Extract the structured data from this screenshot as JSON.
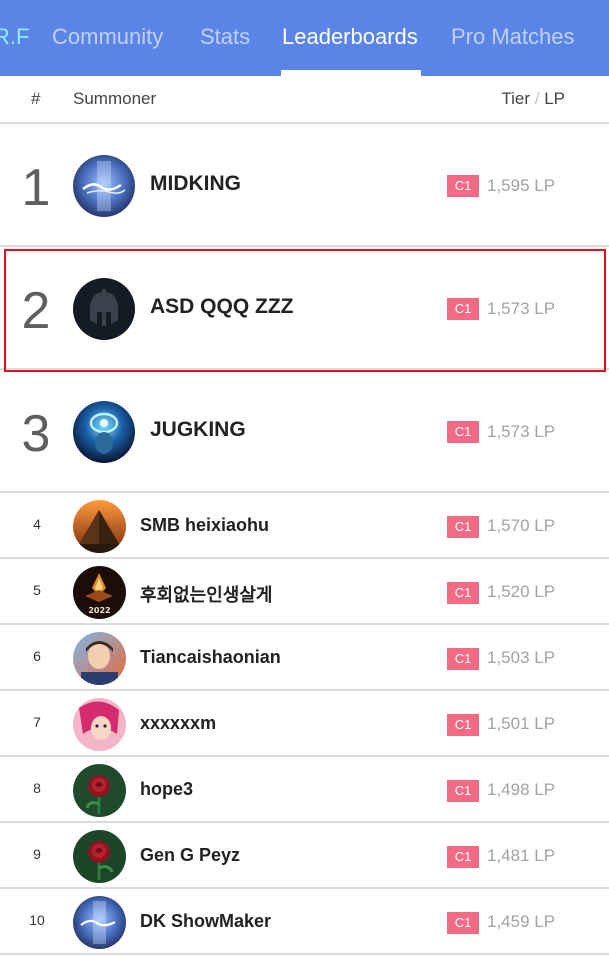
{
  "nav": {
    "tabs": [
      {
        "label": "R.F"
      },
      {
        "label": "Community"
      },
      {
        "label": "Stats"
      },
      {
        "label": "Leaderboards",
        "active": true
      },
      {
        "label": "Pro Matches"
      }
    ]
  },
  "columns": {
    "rank": "#",
    "summoner": "Summoner",
    "tier": "Tier",
    "separator": "/",
    "lp": "LP"
  },
  "rows": [
    {
      "rank": "1",
      "name": "MIDKING",
      "tier": "C1",
      "lp": "1,595 LP",
      "avatar": "showmaker-avatar"
    },
    {
      "rank": "2",
      "name": "ASD QQQ ZZZ",
      "tier": "C1",
      "lp": "1,573 LP",
      "avatar": "spartan-helmet-avatar",
      "highlighted": true
    },
    {
      "rank": "3",
      "name": "JUGKING",
      "tier": "C1",
      "lp": "1,573 LP",
      "avatar": "blue-eye-mage-avatar"
    },
    {
      "rank": "4",
      "name": "SMB heixiaohu",
      "tier": "C1",
      "lp": "1,570 LP",
      "avatar": "pyramid-avatar"
    },
    {
      "rank": "5",
      "name": "후회없는인생살게",
      "tier": "C1",
      "lp": "1,520 LP",
      "avatar": "2022-emblem-avatar",
      "avatar_text": "2022"
    },
    {
      "rank": "6",
      "name": "Tiancaishaonian",
      "tier": "C1",
      "lp": "1,503 LP",
      "avatar": "portrait-avatar"
    },
    {
      "rank": "7",
      "name": "xxxxxxm",
      "tier": "C1",
      "lp": "1,501 LP",
      "avatar": "pink-hair-champion-avatar"
    },
    {
      "rank": "8",
      "name": "hope3",
      "tier": "C1",
      "lp": "1,498 LP",
      "avatar": "rose-avatar"
    },
    {
      "rank": "9",
      "name": "Gen G Peyz",
      "tier": "C1",
      "lp": "1,481 LP",
      "avatar": "rose-avatar"
    },
    {
      "rank": "10",
      "name": "DK ShowMaker",
      "tier": "C1",
      "lp": "1,459 LP",
      "avatar": "showmaker-avatar"
    }
  ],
  "colors": {
    "nav_background": "#5a84e6",
    "tier_badge": "#f26a83",
    "highlight_border": "#e0131c"
  }
}
